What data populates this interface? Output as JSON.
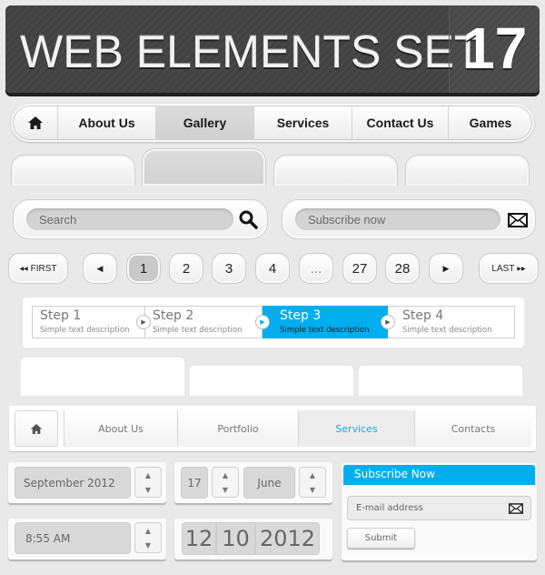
{
  "banner": {
    "title": "WEB ELEMENTS SET",
    "number": "17"
  },
  "top_nav": {
    "items": [
      {
        "label": "About Us"
      },
      {
        "label": "Gallery",
        "active": true
      },
      {
        "label": "Services"
      },
      {
        "label": "Contact Us"
      },
      {
        "label": "Games"
      }
    ]
  },
  "search": {
    "placeholder": "Search"
  },
  "subscribe_bar": {
    "placeholder": "Subscribe now"
  },
  "pagination": {
    "first": "FIRST",
    "last": "LAST",
    "pages": [
      "1",
      "2",
      "3",
      "4",
      "...",
      "27",
      "28"
    ],
    "current": "1",
    "first_glyph": "◀◀",
    "last_glyph": "▶▶",
    "prev_glyph": "◀",
    "next_glyph": "▶"
  },
  "steps": [
    {
      "title": "Step 1",
      "desc": "Simple text description"
    },
    {
      "title": "Step 2",
      "desc": "Simple text description"
    },
    {
      "title": "Step 3",
      "desc": "Simple text description",
      "active": true
    },
    {
      "title": "Step 4",
      "desc": "Simple text description"
    }
  ],
  "nav2": {
    "items": [
      {
        "label": "About Us"
      },
      {
        "label": "Portfolio"
      },
      {
        "label": "Services",
        "active": true
      },
      {
        "label": "Contacts"
      }
    ]
  },
  "pickers": {
    "month_year": "September   2012",
    "day": "17",
    "month": "June",
    "time": "8:55 AM",
    "date_day": "12",
    "date_month": "10",
    "date_year": "2012",
    "up": "▲",
    "down": "▼"
  },
  "subscribe_widget": {
    "title": "Subscribe Now",
    "email_placeholder": "E-mail address",
    "submit": "Submit"
  },
  "colors": {
    "accent": "#00aeef",
    "banner_bg": "#444444",
    "page_bg": "#e9e9e9"
  }
}
